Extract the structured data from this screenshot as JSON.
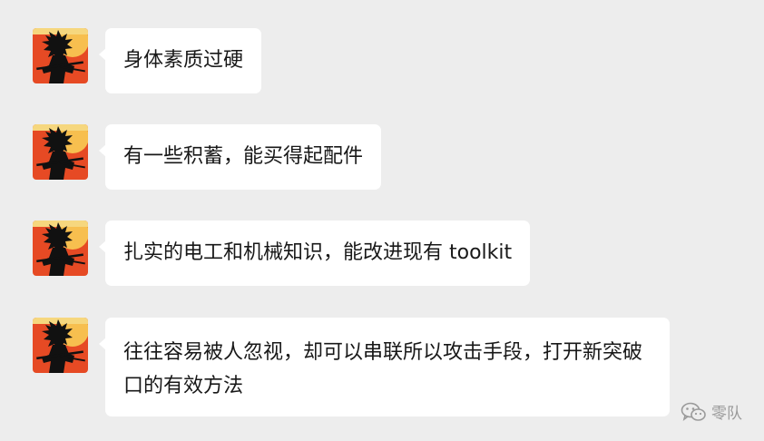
{
  "messages": [
    {
      "text": "身体素质过硬",
      "avatar_icon": "samurai-silhouette-avatar"
    },
    {
      "text": "有一些积蓄，能买得起配件",
      "avatar_icon": "samurai-silhouette-avatar"
    },
    {
      "text": "扎实的电工和机械知识，能改进现有 toolkit",
      "avatar_icon": "samurai-silhouette-avatar"
    },
    {
      "text": "往往容易被人忽视，却可以串联所以攻击手段，打开新突破口的有效方法",
      "avatar_icon": "samurai-silhouette-avatar"
    }
  ],
  "watermark": {
    "label": "零队",
    "icon": "wechat-logo-icon"
  },
  "colors": {
    "background": "#ededed",
    "bubble": "#ffffff",
    "avatar_bg": "#e8502b",
    "avatar_sun": "#f6c35a"
  }
}
